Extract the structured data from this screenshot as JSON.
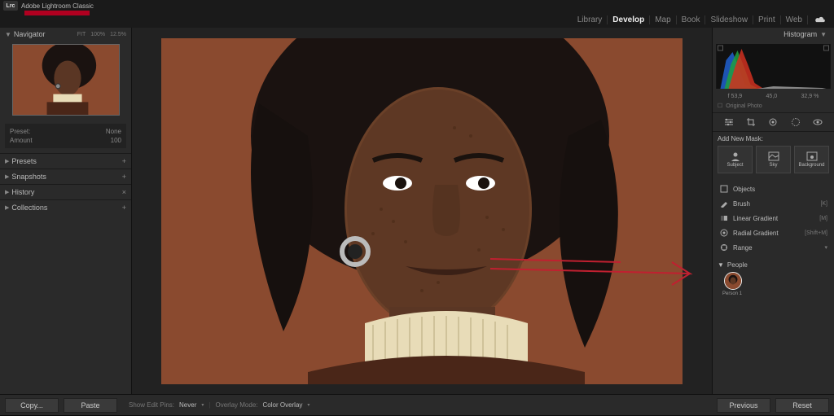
{
  "app": {
    "badge": "Lrc",
    "title": "Adobe Lightroom Classic"
  },
  "modules": [
    "Library",
    "Develop",
    "Map",
    "Book",
    "Slideshow",
    "Print",
    "Web"
  ],
  "active_module": "Develop",
  "navigator": {
    "title": "Navigator",
    "fit": "FIT",
    "pct": "100%",
    "pct2": "12.5%"
  },
  "preset_info": {
    "preset_label": "Preset:",
    "preset_val": "None",
    "amount_label": "Amount",
    "amount_val": "100"
  },
  "left_accordion": [
    {
      "label": "Presets",
      "tail": "+"
    },
    {
      "label": "Snapshots",
      "tail": "+"
    },
    {
      "label": "History",
      "tail": "×"
    },
    {
      "label": "Collections",
      "tail": "+"
    }
  ],
  "histogram": {
    "title": "Histogram",
    "values": {
      "f": "f 53,9",
      "mm": "45,0",
      "pct": "32,9 %"
    },
    "original": "Original Photo"
  },
  "masking": {
    "add_label": "Add New Mask:",
    "buttons": [
      {
        "name": "subject",
        "label": "Subject"
      },
      {
        "name": "sky",
        "label": "Sky"
      },
      {
        "name": "background",
        "label": "Background"
      }
    ],
    "tools": [
      {
        "icon": "objects",
        "label": "Objects",
        "short": ""
      },
      {
        "icon": "brush",
        "label": "Brush",
        "short": "[K]"
      },
      {
        "icon": "linear",
        "label": "Linear Gradient",
        "short": "[M]"
      },
      {
        "icon": "radial",
        "label": "Radial Gradient",
        "short": "[Shift+M]"
      },
      {
        "icon": "range",
        "label": "Range",
        "short": ""
      }
    ],
    "people": {
      "header": "People",
      "person1": "Person 1"
    }
  },
  "bottom": {
    "copy": "Copy...",
    "paste": "Paste",
    "show_pins_label": "Show Edit Pins:",
    "show_pins_val": "Never",
    "overlay_mode_label": "Overlay Mode:",
    "overlay_mode_val": "Color Overlay",
    "previous": "Previous",
    "reset": "Reset"
  }
}
